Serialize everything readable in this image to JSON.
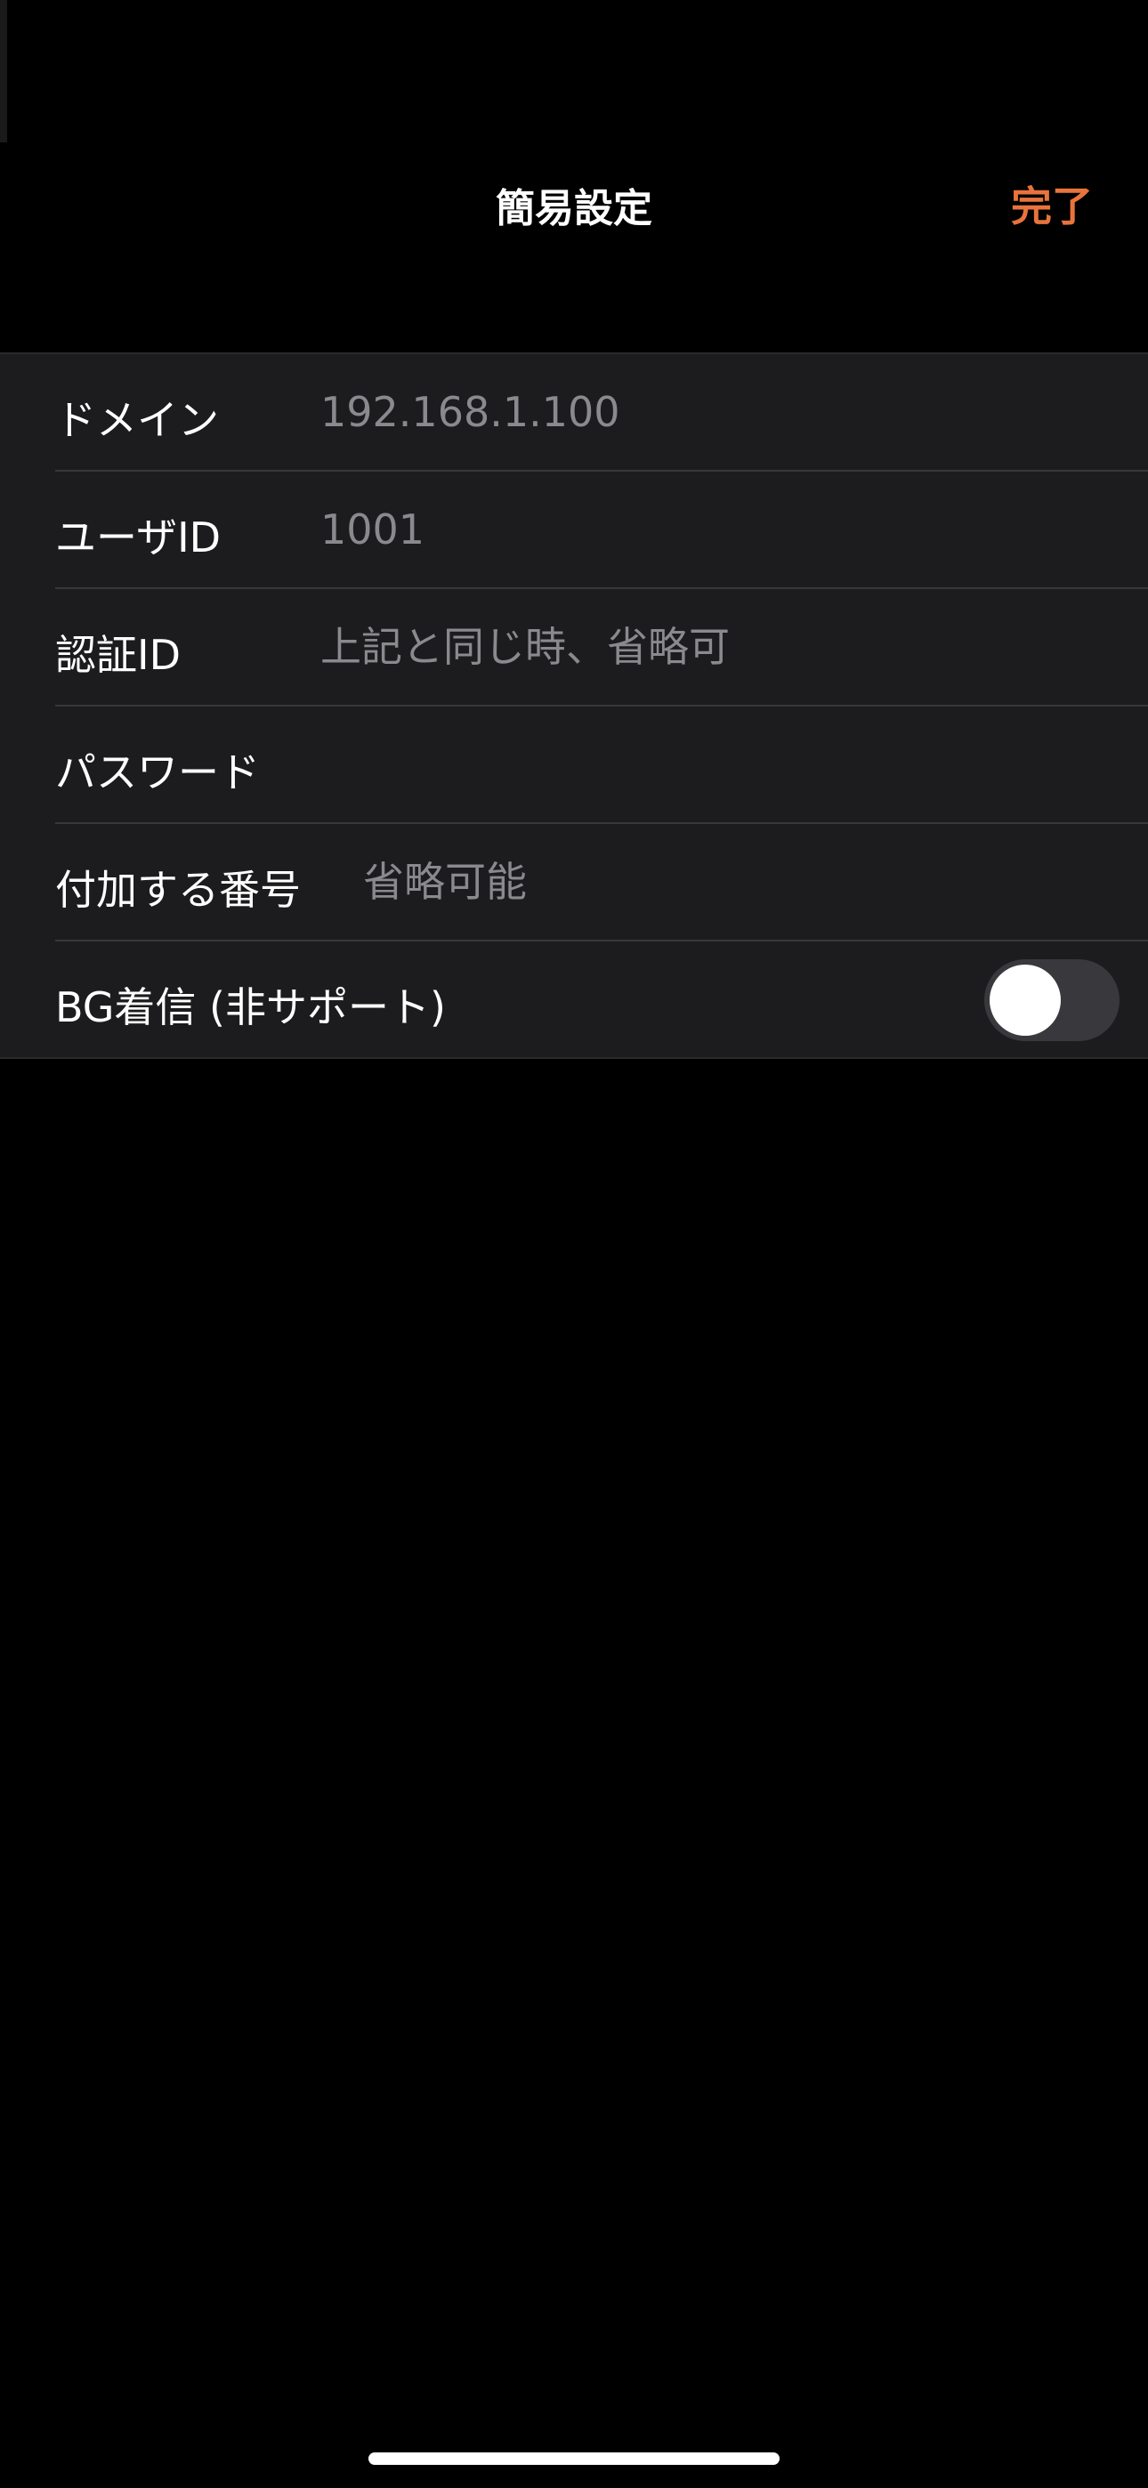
{
  "nav": {
    "title": "簡易設定",
    "done_label": "完了",
    "accent_color": "#e8743b"
  },
  "form": {
    "rows": [
      {
        "label": "ドメイン",
        "value": "",
        "placeholder": "192.168.1.100"
      },
      {
        "label": "ユーザID",
        "value": "",
        "placeholder": "1001"
      },
      {
        "label": "認証ID",
        "value": "",
        "placeholder": "上記と同じ時、省略可"
      },
      {
        "label": "パスワード",
        "value": "",
        "placeholder": ""
      },
      {
        "label": "付加する番号",
        "value": "",
        "placeholder": "省略可能"
      }
    ],
    "bg_incoming": {
      "label": "BG着信 (非サポート)",
      "enabled": false
    }
  }
}
